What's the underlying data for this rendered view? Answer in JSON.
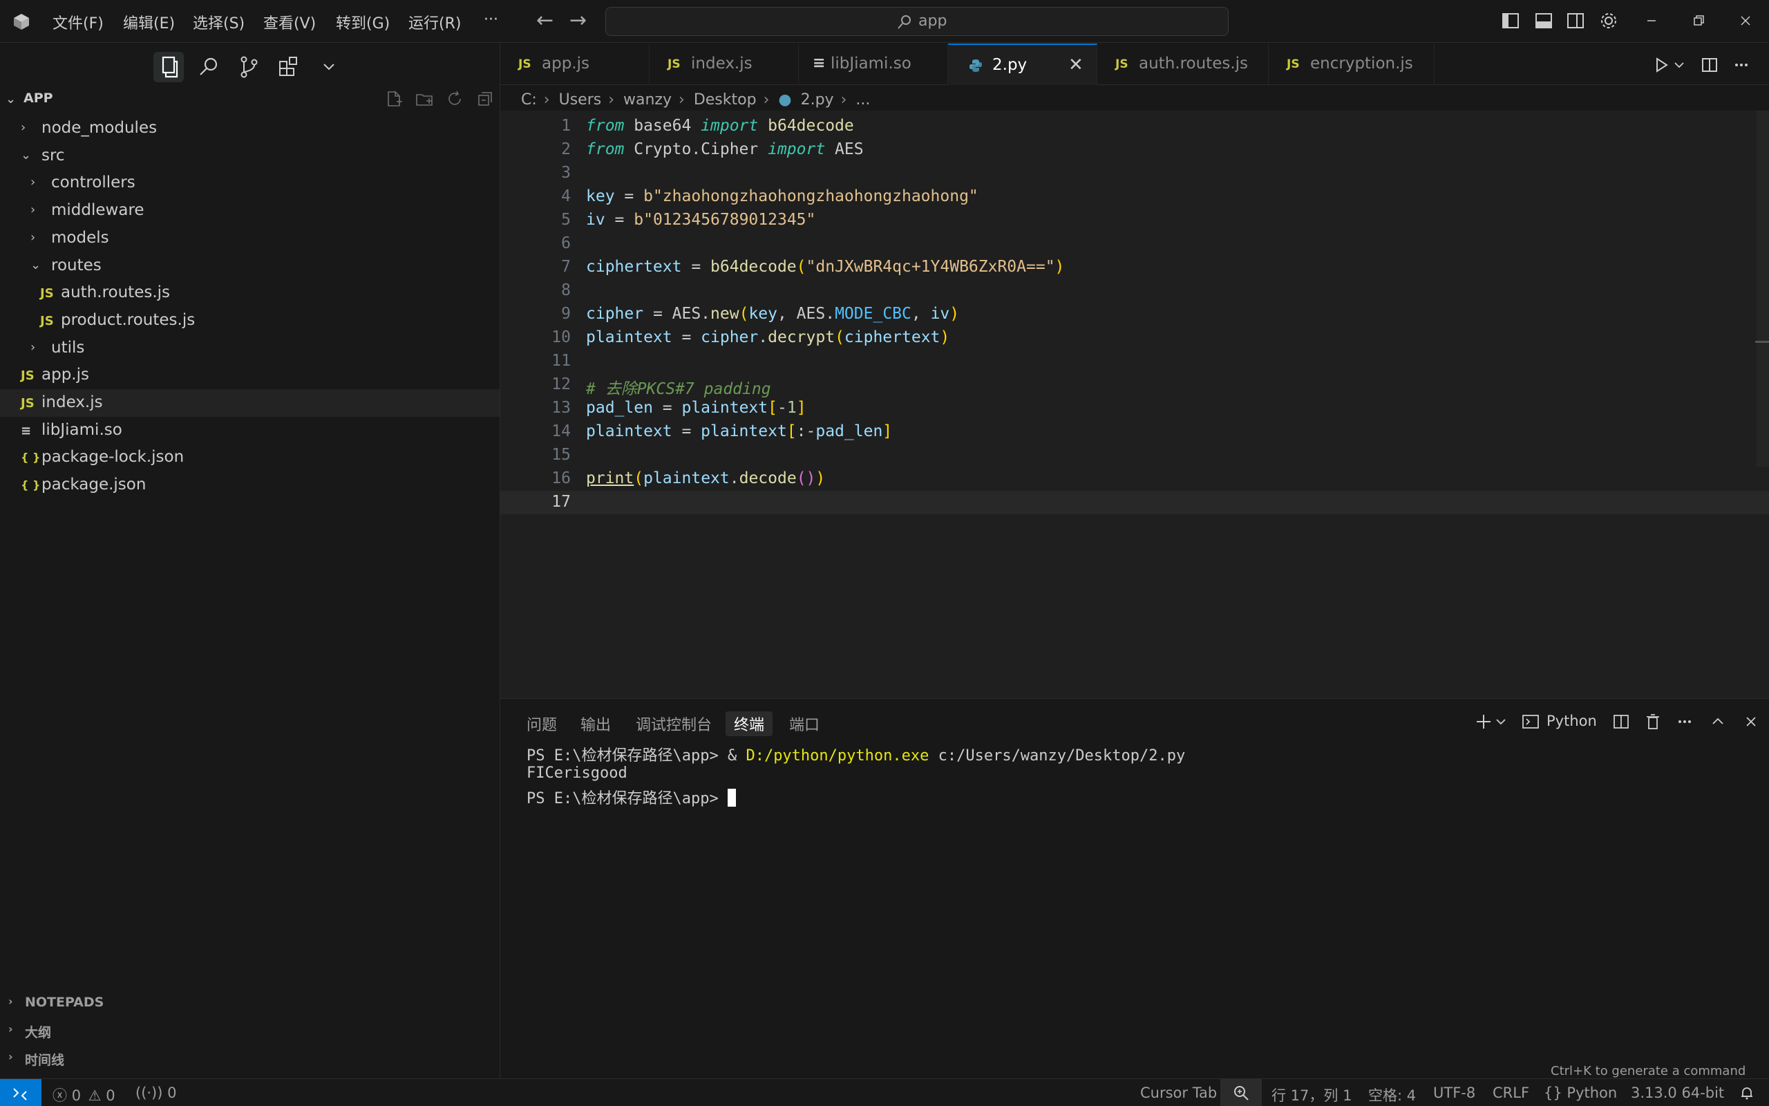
{
  "titlebar": {
    "menus": [
      "文件(F)",
      "编辑(E)",
      "选择(S)",
      "查看(V)",
      "转到(G)",
      "运行(R)"
    ],
    "more": "···",
    "search_text": "app"
  },
  "explorer": {
    "title": "APP",
    "tree": [
      {
        "name": "node_modules",
        "type": "folder",
        "depth": 0,
        "open": false
      },
      {
        "name": "src",
        "type": "folder",
        "depth": 0,
        "open": true
      },
      {
        "name": "controllers",
        "type": "folder",
        "depth": 1,
        "open": false
      },
      {
        "name": "middleware",
        "type": "folder",
        "depth": 1,
        "open": false
      },
      {
        "name": "models",
        "type": "folder",
        "depth": 1,
        "open": false
      },
      {
        "name": "routes",
        "type": "folder",
        "depth": 1,
        "open": true
      },
      {
        "name": "auth.routes.js",
        "type": "js",
        "depth": 2
      },
      {
        "name": "product.routes.js",
        "type": "js",
        "depth": 2
      },
      {
        "name": "utils",
        "type": "folder",
        "depth": 1,
        "open": false
      },
      {
        "name": "app.js",
        "type": "js",
        "depth": 0
      },
      {
        "name": "index.js",
        "type": "js",
        "depth": 0
      },
      {
        "name": "libJiami.so",
        "type": "file",
        "depth": 0
      },
      {
        "name": "package-lock.json",
        "type": "json",
        "depth": 0
      },
      {
        "name": "package.json",
        "type": "json",
        "depth": 0
      }
    ],
    "sections": [
      "NOTEPADS",
      "大纲",
      "时间线"
    ]
  },
  "tabs": [
    {
      "label": "app.js",
      "icon": "JS"
    },
    {
      "label": "index.js",
      "icon": "JS"
    },
    {
      "label": "libJiami.so",
      "icon": "≡"
    },
    {
      "label": "2.py",
      "icon": "py",
      "active": true
    },
    {
      "label": "auth.routes.js",
      "icon": "JS"
    },
    {
      "label": "encryption.js",
      "icon": "JS"
    }
  ],
  "breadcrumb": [
    "C:",
    "Users",
    "wanzy",
    "Desktop",
    "2.py",
    "..."
  ],
  "code": {
    "current_line": 17,
    "line_numbers": [
      "1",
      "2",
      "3",
      "4",
      "5",
      "6",
      "7",
      "8",
      "9",
      "10",
      "11",
      "12",
      "13",
      "14",
      "15",
      "16",
      "17"
    ]
  },
  "panel": {
    "tabs": [
      "问题",
      "输出",
      "调试控制台",
      "终端",
      "端口"
    ],
    "active_tab": "终端",
    "terminal_profile": "Python",
    "terminal": {
      "line1_prompt": "PS E:\\检材保存路径\\app> ",
      "line1_amp": "& ",
      "line1_exe": "D:/python/python.exe",
      "line1_arg": " c:/Users/wanzy/Desktop/2.py",
      "line2": "FICerisgood",
      "line3_prompt": "PS E:\\检材保存路径\\app> "
    },
    "hint": "Ctrl+K to generate a command"
  },
  "statusbar": {
    "errors": "0",
    "warnings": "0",
    "ports": "0",
    "cursor_tab": "Cursor Tab",
    "position": "行 17，列 1",
    "spaces": "空格: 4",
    "encoding": "UTF-8",
    "eol": "CRLF",
    "language": "Python",
    "interpreter": "3.13.0 64-bit"
  }
}
